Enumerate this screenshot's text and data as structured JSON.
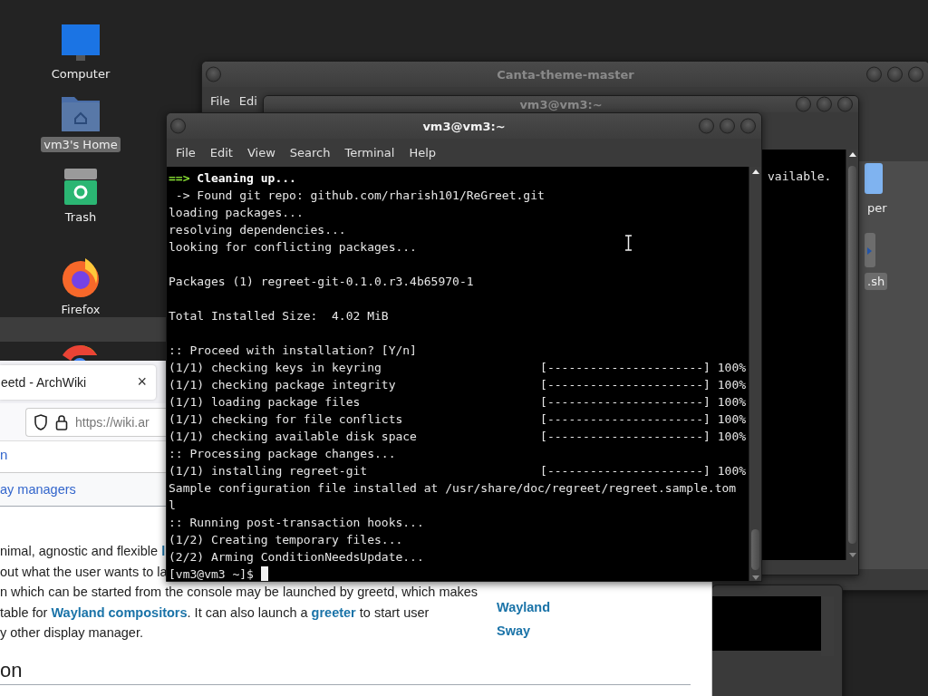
{
  "desktop_icons": [
    {
      "kind": "computer",
      "label": "Computer",
      "selected": false
    },
    {
      "kind": "home",
      "label": "vm3's Home",
      "selected": true
    },
    {
      "kind": "trash",
      "label": "Trash",
      "selected": false
    },
    {
      "kind": "firefox",
      "label": "Firefox",
      "selected": false
    },
    {
      "kind": "chrome"
    }
  ],
  "file_manager": {
    "title": "Canta-theme-master",
    "menu": [
      "File",
      "Edi"
    ],
    "items": [
      {
        "kind": "folder",
        "label": "per",
        "selected": false
      },
      {
        "kind": "script",
        "label": ".sh",
        "selected": true
      }
    ]
  },
  "back_terminal": {
    "title": "vm3@vm3:~",
    "lines": [
      "vailable."
    ]
  },
  "terminal": {
    "title": "vm3@vm3:~",
    "menu": [
      "File",
      "Edit",
      "View",
      "Search",
      "Terminal",
      "Help"
    ],
    "lines": [
      {
        "kind": "heading",
        "marker": "==>",
        "text": "Cleaning up..."
      },
      {
        "kind": "plain",
        "text": " -> Found git repo: github.com/rharish101/ReGreet.git"
      },
      {
        "kind": "plain",
        "text": "loading packages..."
      },
      {
        "kind": "plain",
        "text": "resolving dependencies..."
      },
      {
        "kind": "plain",
        "text": "looking for conflicting packages..."
      },
      {
        "kind": "blank"
      },
      {
        "kind": "plain",
        "text": "Packages (1) regreet-git-0.1.0.r3.4b65970-1"
      },
      {
        "kind": "blank"
      },
      {
        "kind": "plain",
        "text": "Total Installed Size:  4.02 MiB"
      },
      {
        "kind": "blank"
      },
      {
        "kind": "plain",
        "text": ":: Proceed with installation? [Y/n]"
      },
      {
        "kind": "progress",
        "text": "(1/1) checking keys in keyring",
        "bar": "[----------------------]",
        "percent": "100%"
      },
      {
        "kind": "progress",
        "text": "(1/1) checking package integrity",
        "bar": "[----------------------]",
        "percent": "100%"
      },
      {
        "kind": "progress",
        "text": "(1/1) loading package files",
        "bar": "[----------------------]",
        "percent": "100%"
      },
      {
        "kind": "progress",
        "text": "(1/1) checking for file conflicts",
        "bar": "[----------------------]",
        "percent": "100%"
      },
      {
        "kind": "progress",
        "text": "(1/1) checking available disk space",
        "bar": "[----------------------]",
        "percent": "100%"
      },
      {
        "kind": "plain",
        "text": ":: Processing package changes..."
      },
      {
        "kind": "progress",
        "text": "(1/1) installing regreet-git",
        "bar": "[----------------------]",
        "percent": "100%"
      },
      {
        "kind": "plain",
        "text": "Sample configuration file installed at /usr/share/doc/regreet/regreet.sample.tom"
      },
      {
        "kind": "plain",
        "text": "l"
      },
      {
        "kind": "plain",
        "text": ":: Running post-transaction hooks..."
      },
      {
        "kind": "plain",
        "text": "(1/2) Creating temporary files..."
      },
      {
        "kind": "plain",
        "text": "(2/2) Arming ConditionNeedsUpdate..."
      },
      {
        "kind": "prompt",
        "text": "[vm3@vm3 ~]$"
      }
    ]
  },
  "browser": {
    "tab": {
      "title": "eetd - ArchWiki",
      "close": "×"
    },
    "url": "https://wiki.ar",
    "nav_link": "n",
    "breadcrumb": "ay managers",
    "paragraph": [
      [
        {
          "text": "nimal, agnostic and flexible ",
          "link": false
        },
        {
          "text": "l",
          "link": true
        }
      ],
      [
        {
          "text": "out what the user wants to la",
          "link": false
        }
      ],
      [
        {
          "text": "n which can be started from the console may be launched by greetd, which makes",
          "link": false
        }
      ],
      [
        {
          "text": "table for ",
          "link": false
        },
        {
          "text": "Wayland compositors",
          "link": true
        },
        {
          "text": ". It can also launch a ",
          "link": false
        },
        {
          "text": "greeter",
          "link": true
        },
        {
          "text": " to start user",
          "link": false
        }
      ],
      [
        {
          "text": "y other display manager.",
          "link": false
        }
      ]
    ],
    "related": [
      "Wayland",
      "Sway"
    ],
    "heading": "on"
  }
}
